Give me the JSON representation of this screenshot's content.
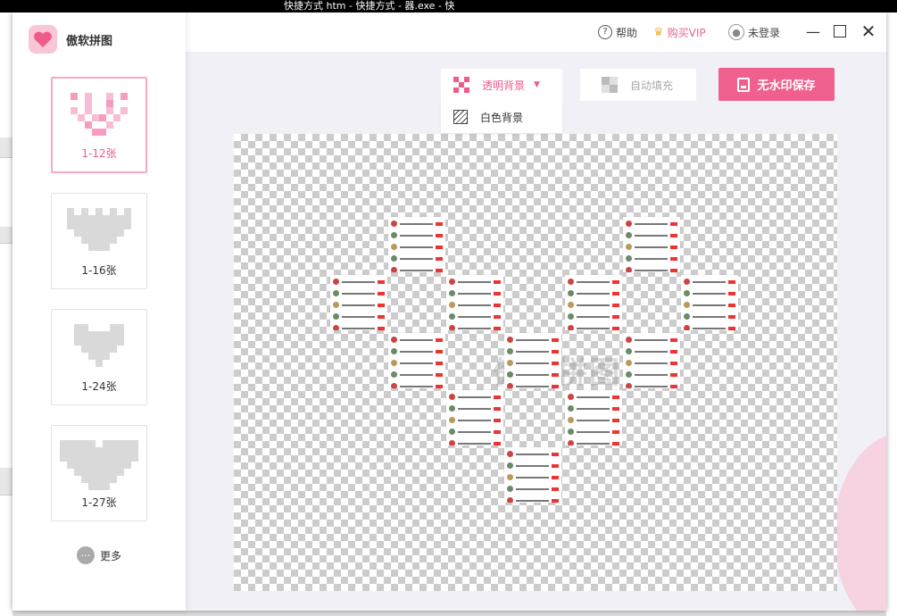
{
  "desktop": {
    "taskbar_text": "快捷方式  htm  - 快捷方式 - 器.exe - 快"
  },
  "app": {
    "title": "傲软拼图"
  },
  "templates": [
    {
      "label": "1-12张",
      "active": true,
      "color": "#f59cbf"
    },
    {
      "label": "1-16张",
      "active": false,
      "color": "#d9d9d9"
    },
    {
      "label": "1-24张",
      "active": false,
      "color": "#d9d9d9"
    },
    {
      "label": "1-27张",
      "active": false,
      "color": "#d9d9d9"
    }
  ],
  "more_label": "更多",
  "topbar": {
    "help": "帮助",
    "vip": "购买VIP",
    "login": "未登录"
  },
  "toolbar": {
    "transparent_bg": "透明背景",
    "white_bg": "白色背景",
    "auto_fill": "自动填充",
    "save": "无水印保存"
  },
  "watermark": "傲软拼图",
  "colors": {
    "accent": "#f0608e",
    "accent_text": "#ee5c8a",
    "canvas_bg": "#f0f0f6"
  }
}
